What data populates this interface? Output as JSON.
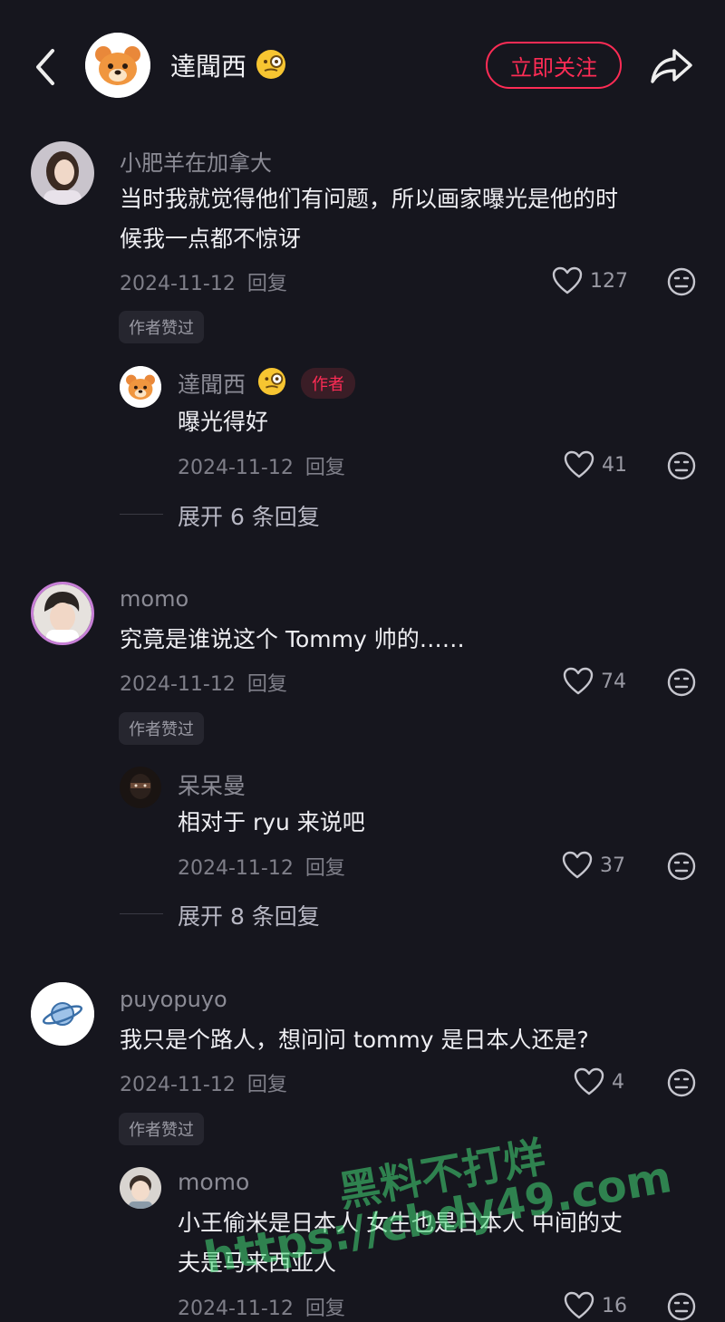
{
  "header": {
    "author_name": "達聞西",
    "follow_label": "立即关注"
  },
  "comments": [
    {
      "user": "小肥羊在加拿大",
      "text_lines": [
        "当时我就觉得他们有问题，所以画家曝光是他的时",
        "候我一点都不惊讶"
      ],
      "date": "2024-11-12",
      "reply_label": "回复",
      "likes": "127",
      "tag": "作者赞过",
      "reply": {
        "user": "達聞西",
        "badge": "作者",
        "text": "曝光得好",
        "date": "2024-11-12",
        "reply_label": "回复",
        "likes": "41"
      },
      "expand": "展开 6 条回复"
    },
    {
      "user": "momo",
      "text_lines": [
        "究竟是谁说这个 Tommy 帅的……"
      ],
      "date": "2024-11-12",
      "reply_label": "回复",
      "likes": "74",
      "tag": "作者赞过",
      "reply": {
        "user": "呆呆曼",
        "text": "相对于 ryu 来说吧",
        "date": "2024-11-12",
        "reply_label": "回复",
        "likes": "37"
      },
      "expand": "展开 8 条回复"
    },
    {
      "user": "puyopuyo",
      "text_lines": [
        "我只是个路人，想问问 tommy 是日本人还是?"
      ],
      "date": "2024-11-12",
      "reply_label": "回复",
      "likes": "4",
      "tag": "作者赞过",
      "reply": {
        "user": "momo",
        "text_lines": [
          "小王偷米是日本人 女生也是日本人 中间的丈",
          "夫是马来西亚人"
        ],
        "date": "2024-11-12",
        "reply_label": "回复",
        "likes": "16"
      }
    }
  ],
  "watermark": {
    "line1": "黑料不打烊",
    "line2": "https://cbdy49.com"
  },
  "icons": {
    "back": "chevron-left-icon",
    "share": "share-arrow-icon",
    "like": "heart-outline-icon",
    "dislike": "neutral-face-icon"
  },
  "colors": {
    "accent": "#fe2c55",
    "background": "#16161e"
  }
}
